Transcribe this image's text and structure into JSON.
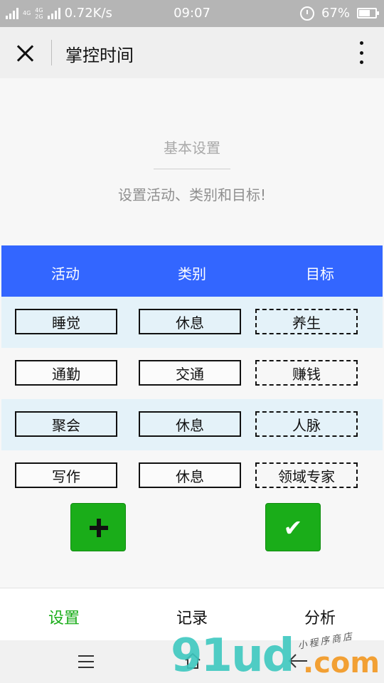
{
  "status_bar": {
    "network_primary": "4G",
    "network_secondary_top": "4G",
    "network_secondary_bottom": "2G",
    "speed": "0.72K/s",
    "time": "09:07",
    "battery": "67%",
    "battery_level": 0.67
  },
  "nav": {
    "title": "掌控时间"
  },
  "intro": {
    "title": "基本设置",
    "subtitle": "设置活动、类别和目标!"
  },
  "table": {
    "headers": [
      "活动",
      "类别",
      "目标"
    ],
    "rows": [
      {
        "activity": "睡觉",
        "category": "休息",
        "goal": "养生"
      },
      {
        "activity": "通勤",
        "category": "交通",
        "goal": "赚钱"
      },
      {
        "activity": "聚会",
        "category": "休息",
        "goal": "人脉"
      },
      {
        "activity": "写作",
        "category": "休息",
        "goal": "领域专家"
      }
    ]
  },
  "actions": {
    "add_icon": "plus-icon",
    "confirm_icon": "check-icon",
    "confirm_glyph": "✔",
    "accent_color": "#1aad19"
  },
  "tabs": [
    {
      "label": "设置",
      "active": true
    },
    {
      "label": "记录",
      "active": false
    },
    {
      "label": "分析",
      "active": false
    }
  ],
  "watermark": {
    "logo": "91ud",
    "suffix": ".com",
    "tagline": "小程序商店"
  },
  "colors": {
    "header_blue": "#3366ff",
    "row_shade": "#e4f2f9",
    "active_tab": "#1aad19"
  }
}
